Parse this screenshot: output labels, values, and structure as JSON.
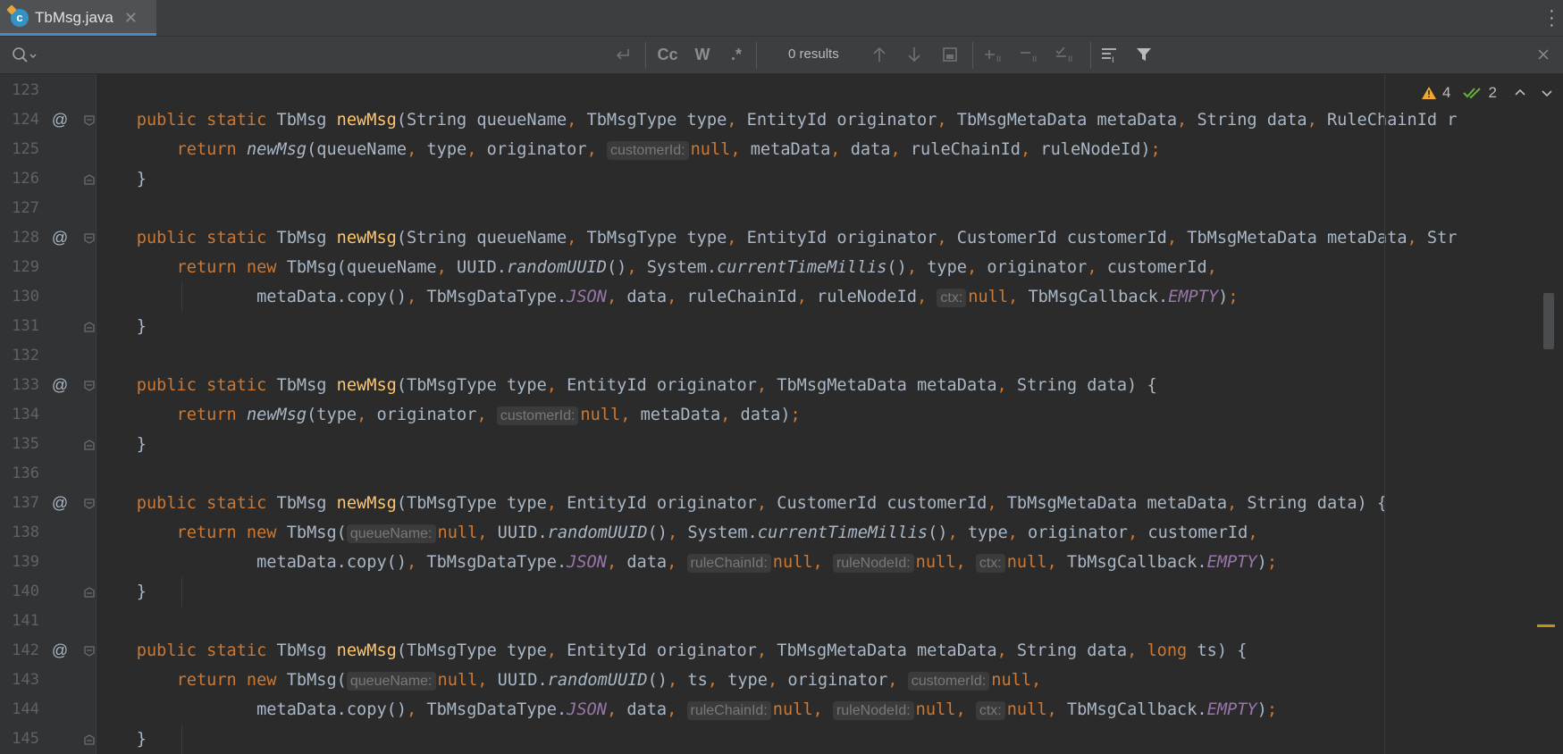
{
  "tab": {
    "label": "TbMsg.java",
    "icon": "c",
    "close": "✕"
  },
  "find": {
    "placeholder": "",
    "results": "0 results",
    "case_label": "Cc",
    "word_label": "W",
    "regex_label": ".*"
  },
  "inspection": {
    "warnings": "4",
    "ok": "2"
  },
  "colors": {
    "keyword": "#cc7832",
    "method": "#ffc66d",
    "constant": "#9876aa",
    "text": "#a9b7c6",
    "hint": "#787878"
  },
  "lines": [
    {
      "n": "123",
      "ann": "",
      "fold": "",
      "tokens": []
    },
    {
      "n": "124",
      "ann": "@",
      "fold": "open",
      "tokens": [
        [
          "k",
          "    public static "
        ],
        [
          "p",
          "TbMsg "
        ],
        [
          "f",
          "newMsg"
        ],
        [
          "p",
          "(String queueName"
        ],
        [
          "k",
          ", "
        ],
        [
          "p",
          "TbMsgType type"
        ],
        [
          "k",
          ", "
        ],
        [
          "p",
          "EntityId originator"
        ],
        [
          "k",
          ", "
        ],
        [
          "p",
          "TbMsgMetaData metaData"
        ],
        [
          "k",
          ", "
        ],
        [
          "p",
          "String data"
        ],
        [
          "k",
          ", "
        ],
        [
          "p",
          "RuleChainId r"
        ]
      ]
    },
    {
      "n": "125",
      "ann": "",
      "fold": "",
      "tokens": [
        [
          "p",
          "        "
        ],
        [
          "k",
          "return "
        ],
        [
          "i",
          "newMsg"
        ],
        [
          "p",
          "(queueName"
        ],
        [
          "k",
          ", "
        ],
        [
          "p",
          "type"
        ],
        [
          "k",
          ", "
        ],
        [
          "p",
          "originator"
        ],
        [
          "k",
          ", "
        ],
        [
          "h",
          "customerId:"
        ],
        [
          "k",
          "null, "
        ],
        [
          "p",
          "metaData"
        ],
        [
          "k",
          ", "
        ],
        [
          "p",
          "data"
        ],
        [
          "k",
          ", "
        ],
        [
          "p",
          "ruleChainId"
        ],
        [
          "k",
          ", "
        ],
        [
          "p",
          "ruleNodeId)"
        ],
        [
          "k",
          ";"
        ]
      ]
    },
    {
      "n": "126",
      "ann": "",
      "fold": "close",
      "tokens": [
        [
          "p",
          "    }"
        ]
      ]
    },
    {
      "n": "127",
      "ann": "",
      "fold": "",
      "tokens": []
    },
    {
      "n": "128",
      "ann": "@",
      "fold": "open",
      "tokens": [
        [
          "k",
          "    public static "
        ],
        [
          "p",
          "TbMsg "
        ],
        [
          "f",
          "newMsg"
        ],
        [
          "p",
          "(String queueName"
        ],
        [
          "k",
          ", "
        ],
        [
          "p",
          "TbMsgType type"
        ],
        [
          "k",
          ", "
        ],
        [
          "p",
          "EntityId originator"
        ],
        [
          "k",
          ", "
        ],
        [
          "p",
          "CustomerId customerId"
        ],
        [
          "k",
          ", "
        ],
        [
          "p",
          "TbMsgMetaData metaData"
        ],
        [
          "k",
          ", "
        ],
        [
          "p",
          "Str"
        ]
      ]
    },
    {
      "n": "129",
      "ann": "",
      "fold": "",
      "tokens": [
        [
          "p",
          "        "
        ],
        [
          "k",
          "return new "
        ],
        [
          "p",
          "TbMsg(queueName"
        ],
        [
          "k",
          ", "
        ],
        [
          "p",
          "UUID."
        ],
        [
          "i",
          "randomUUID"
        ],
        [
          "p",
          "()"
        ],
        [
          "k",
          ", "
        ],
        [
          "p",
          "System."
        ],
        [
          "i",
          "currentTimeMillis"
        ],
        [
          "p",
          "()"
        ],
        [
          "k",
          ", "
        ],
        [
          "p",
          "type"
        ],
        [
          "k",
          ", "
        ],
        [
          "p",
          "originator"
        ],
        [
          "k",
          ", "
        ],
        [
          "p",
          "customerId"
        ],
        [
          "k",
          ","
        ]
      ]
    },
    {
      "n": "130",
      "ann": "",
      "fold": "",
      "tokens": [
        [
          "p",
          "                metaData.copy()"
        ],
        [
          "k",
          ", "
        ],
        [
          "p",
          "TbMsgDataType."
        ],
        [
          "c",
          "JSON"
        ],
        [
          "k",
          ", "
        ],
        [
          "p",
          "data"
        ],
        [
          "k",
          ", "
        ],
        [
          "p",
          "ruleChainId"
        ],
        [
          "k",
          ", "
        ],
        [
          "p",
          "ruleNodeId"
        ],
        [
          "k",
          ", "
        ],
        [
          "h",
          "ctx:"
        ],
        [
          "k",
          "null, "
        ],
        [
          "p",
          "TbMsgCallback."
        ],
        [
          "c",
          "EMPTY"
        ],
        [
          "p",
          ")"
        ],
        [
          "k",
          ";"
        ]
      ]
    },
    {
      "n": "131",
      "ann": "",
      "fold": "close",
      "tokens": [
        [
          "p",
          "    }"
        ]
      ]
    },
    {
      "n": "132",
      "ann": "",
      "fold": "",
      "tokens": []
    },
    {
      "n": "133",
      "ann": "@",
      "fold": "open",
      "tokens": [
        [
          "k",
          "    public static "
        ],
        [
          "p",
          "TbMsg "
        ],
        [
          "f",
          "newMsg"
        ],
        [
          "p",
          "(TbMsgType type"
        ],
        [
          "k",
          ", "
        ],
        [
          "p",
          "EntityId originator"
        ],
        [
          "k",
          ", "
        ],
        [
          "p",
          "TbMsgMetaData metaData"
        ],
        [
          "k",
          ", "
        ],
        [
          "p",
          "String data) {"
        ]
      ]
    },
    {
      "n": "134",
      "ann": "",
      "fold": "",
      "tokens": [
        [
          "p",
          "        "
        ],
        [
          "k",
          "return "
        ],
        [
          "i",
          "newMsg"
        ],
        [
          "p",
          "(type"
        ],
        [
          "k",
          ", "
        ],
        [
          "p",
          "originator"
        ],
        [
          "k",
          ", "
        ],
        [
          "h",
          "customerId:"
        ],
        [
          "k",
          "null, "
        ],
        [
          "p",
          "metaData"
        ],
        [
          "k",
          ", "
        ],
        [
          "p",
          "data)"
        ],
        [
          "k",
          ";"
        ]
      ]
    },
    {
      "n": "135",
      "ann": "",
      "fold": "close",
      "tokens": [
        [
          "p",
          "    }"
        ]
      ]
    },
    {
      "n": "136",
      "ann": "",
      "fold": "",
      "tokens": []
    },
    {
      "n": "137",
      "ann": "@",
      "fold": "open",
      "tokens": [
        [
          "k",
          "    public static "
        ],
        [
          "p",
          "TbMsg "
        ],
        [
          "f",
          "newMsg"
        ],
        [
          "p",
          "(TbMsgType type"
        ],
        [
          "k",
          ", "
        ],
        [
          "p",
          "EntityId originator"
        ],
        [
          "k",
          ", "
        ],
        [
          "p",
          "CustomerId customerId"
        ],
        [
          "k",
          ", "
        ],
        [
          "p",
          "TbMsgMetaData metaData"
        ],
        [
          "k",
          ", "
        ],
        [
          "p",
          "String data) {"
        ]
      ]
    },
    {
      "n": "138",
      "ann": "",
      "fold": "",
      "tokens": [
        [
          "p",
          "        "
        ],
        [
          "k",
          "return new "
        ],
        [
          "p",
          "TbMsg("
        ],
        [
          "h",
          "queueName:"
        ],
        [
          "k",
          "null, "
        ],
        [
          "p",
          "UUID."
        ],
        [
          "i",
          "randomUUID"
        ],
        [
          "p",
          "()"
        ],
        [
          "k",
          ", "
        ],
        [
          "p",
          "System."
        ],
        [
          "i",
          "currentTimeMillis"
        ],
        [
          "p",
          "()"
        ],
        [
          "k",
          ", "
        ],
        [
          "p",
          "type"
        ],
        [
          "k",
          ", "
        ],
        [
          "p",
          "originator"
        ],
        [
          "k",
          ", "
        ],
        [
          "p",
          "customerId"
        ],
        [
          "k",
          ","
        ]
      ]
    },
    {
      "n": "139",
      "ann": "",
      "fold": "",
      "tokens": [
        [
          "p",
          "                metaData.copy()"
        ],
        [
          "k",
          ", "
        ],
        [
          "p",
          "TbMsgDataType."
        ],
        [
          "c",
          "JSON"
        ],
        [
          "k",
          ", "
        ],
        [
          "p",
          "data"
        ],
        [
          "k",
          ", "
        ],
        [
          "h",
          "ruleChainId:"
        ],
        [
          "k",
          "null, "
        ],
        [
          "h",
          "ruleNodeId:"
        ],
        [
          "k",
          "null, "
        ],
        [
          "h",
          "ctx:"
        ],
        [
          "k",
          "null, "
        ],
        [
          "p",
          "TbMsgCallback."
        ],
        [
          "c",
          "EMPTY"
        ],
        [
          "p",
          ")"
        ],
        [
          "k",
          ";"
        ]
      ]
    },
    {
      "n": "140",
      "ann": "",
      "fold": "close",
      "tokens": [
        [
          "p",
          "    }"
        ]
      ]
    },
    {
      "n": "141",
      "ann": "",
      "fold": "",
      "tokens": []
    },
    {
      "n": "142",
      "ann": "@",
      "fold": "open",
      "tokens": [
        [
          "k",
          "    public static "
        ],
        [
          "p",
          "TbMsg "
        ],
        [
          "f",
          "newMsg"
        ],
        [
          "p",
          "(TbMsgType type"
        ],
        [
          "k",
          ", "
        ],
        [
          "p",
          "EntityId originator"
        ],
        [
          "k",
          ", "
        ],
        [
          "p",
          "TbMsgMetaData metaData"
        ],
        [
          "k",
          ", "
        ],
        [
          "p",
          "String data"
        ],
        [
          "k",
          ", long "
        ],
        [
          "p",
          "ts) {"
        ]
      ]
    },
    {
      "n": "143",
      "ann": "",
      "fold": "",
      "tokens": [
        [
          "p",
          "        "
        ],
        [
          "k",
          "return new "
        ],
        [
          "p",
          "TbMsg("
        ],
        [
          "h",
          "queueName:"
        ],
        [
          "k",
          "null, "
        ],
        [
          "p",
          "UUID."
        ],
        [
          "i",
          "randomUUID"
        ],
        [
          "p",
          "()"
        ],
        [
          "k",
          ", "
        ],
        [
          "p",
          "ts"
        ],
        [
          "k",
          ", "
        ],
        [
          "p",
          "type"
        ],
        [
          "k",
          ", "
        ],
        [
          "p",
          "originator"
        ],
        [
          "k",
          ", "
        ],
        [
          "h",
          "customerId:"
        ],
        [
          "k",
          "null,"
        ]
      ]
    },
    {
      "n": "144",
      "ann": "",
      "fold": "",
      "tokens": [
        [
          "p",
          "                metaData.copy()"
        ],
        [
          "k",
          ", "
        ],
        [
          "p",
          "TbMsgDataType."
        ],
        [
          "c",
          "JSON"
        ],
        [
          "k",
          ", "
        ],
        [
          "p",
          "data"
        ],
        [
          "k",
          ", "
        ],
        [
          "h",
          "ruleChainId:"
        ],
        [
          "k",
          "null, "
        ],
        [
          "h",
          "ruleNodeId:"
        ],
        [
          "k",
          "null, "
        ],
        [
          "h",
          "ctx:"
        ],
        [
          "k",
          "null, "
        ],
        [
          "p",
          "TbMsgCallback."
        ],
        [
          "c",
          "EMPTY"
        ],
        [
          "p",
          ")"
        ],
        [
          "k",
          ";"
        ]
      ]
    },
    {
      "n": "145",
      "ann": "",
      "fold": "close",
      "tokens": [
        [
          "p",
          "    }"
        ]
      ]
    }
  ]
}
